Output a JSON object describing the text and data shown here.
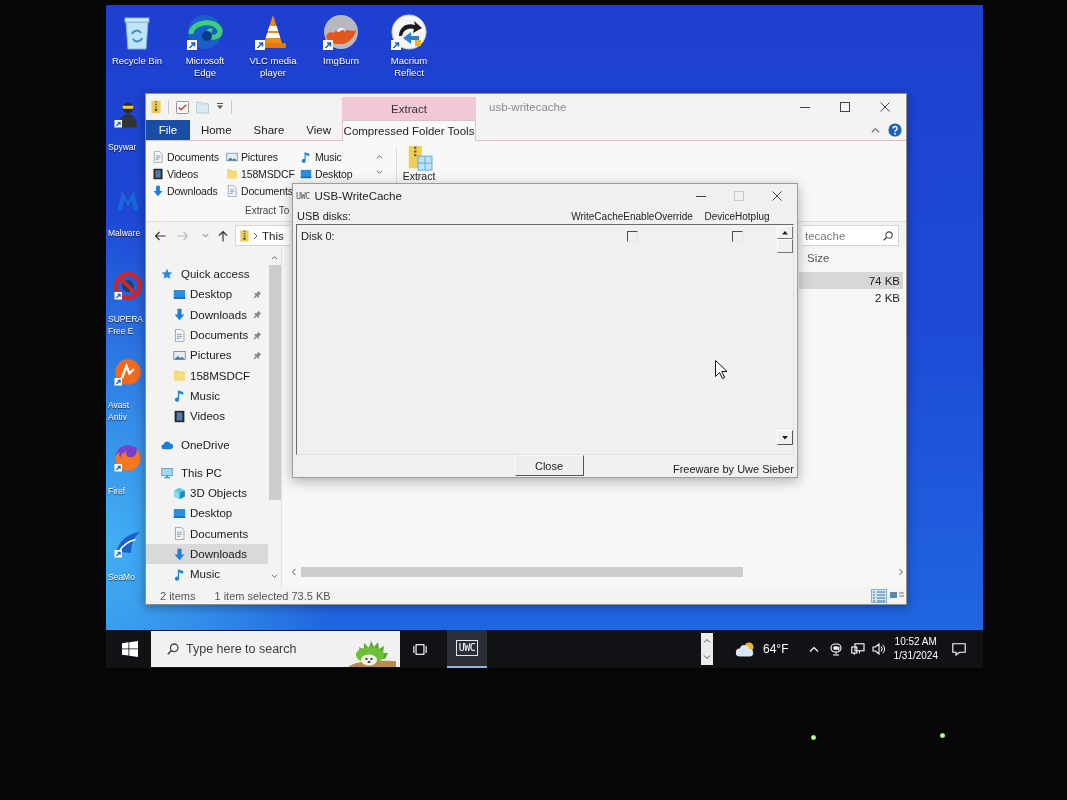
{
  "desktop": {
    "icons": [
      {
        "label": "Recycle Bin"
      },
      {
        "label": "Microsoft Edge"
      },
      {
        "label": "VLC media player"
      },
      {
        "label": "ImgBurn"
      },
      {
        "label": "Macrium Reflect"
      }
    ],
    "side_icons": [
      {
        "lines": [
          "Spywar"
        ]
      },
      {
        "lines": [
          "Malware"
        ]
      },
      {
        "lines": [
          "SUPERA",
          "Free E"
        ]
      },
      {
        "lines": [
          "Avast",
          "Antiv"
        ]
      },
      {
        "lines": [
          "Firef"
        ]
      },
      {
        "lines": [
          "SeaMo"
        ]
      }
    ]
  },
  "explorer": {
    "contextual_tab": "Extract",
    "title": "usb-writecache",
    "tabs": [
      {
        "label": "File",
        "kind": "file",
        "selected": false
      },
      {
        "label": "Home",
        "kind": "tab",
        "selected": false
      },
      {
        "label": "Share",
        "kind": "tab",
        "selected": false
      },
      {
        "label": "View",
        "kind": "tab",
        "selected": false
      },
      {
        "label": "Compressed Folder Tools",
        "kind": "contextual",
        "selected": true
      }
    ],
    "ribbon": {
      "locations": [
        {
          "label": "Documents"
        },
        {
          "label": "Pictures"
        },
        {
          "label": "Music"
        },
        {
          "label": "Videos"
        },
        {
          "label": "158MSDCF"
        },
        {
          "label": "Desktop"
        },
        {
          "label": "Downloads"
        },
        {
          "label": "Documents"
        }
      ],
      "group_label": "Extract To",
      "extract_button": "Extract"
    },
    "address": {
      "path": "This"
    },
    "search": {
      "placeholder": "tecache"
    },
    "nav": [
      {
        "label": "Quick access",
        "selected": false,
        "children": [
          {
            "label": "Desktop",
            "pinned": true,
            "selected": false
          },
          {
            "label": "Downloads",
            "pinned": true,
            "selected": false
          },
          {
            "label": "Documents",
            "pinned": true,
            "selected": false
          },
          {
            "label": "Pictures",
            "pinned": true,
            "selected": false
          },
          {
            "label": "158MSDCF",
            "pinned": false,
            "selected": false
          },
          {
            "label": "Music",
            "pinned": false,
            "selected": false
          },
          {
            "label": "Videos",
            "pinned": false,
            "selected": false
          }
        ]
      },
      {
        "label": "OneDrive",
        "selected": false
      },
      {
        "label": "This PC",
        "selected": false,
        "children": [
          {
            "label": "3D Objects",
            "selected": false
          },
          {
            "label": "Desktop",
            "selected": false
          },
          {
            "label": "Documents",
            "selected": false
          },
          {
            "label": "Downloads",
            "selected": true
          },
          {
            "label": "Music",
            "selected": false
          }
        ]
      }
    ],
    "files": {
      "columns": [
        "Size"
      ],
      "rows": [
        {
          "size": "74 KB",
          "selected": true
        },
        {
          "size": "2 KB",
          "selected": false
        }
      ]
    },
    "status_bar": {
      "count": "2 items",
      "selection": "1 item selected 73.5 KB"
    },
    "views": [
      {
        "selected": true
      },
      {
        "selected": false
      }
    ]
  },
  "dialog": {
    "icon_label": "UWC",
    "title": "USB-WriteCache",
    "controls": [
      {
        "kind": "minimize",
        "disabled": false
      },
      {
        "kind": "maximize",
        "disabled": true
      },
      {
        "kind": "close",
        "disabled": false
      }
    ],
    "list_label": "USB disks:",
    "columns": [
      "WriteCacheEnableOverride",
      "DeviceHotplug"
    ],
    "disks": [
      {
        "name": "Disk 0:",
        "options": [
          {
            "checked": false
          },
          {
            "checked": false
          }
        ]
      }
    ],
    "close_button": "Close",
    "credit": "Freeware by Uwe Sieber"
  },
  "taskbar": {
    "search": {
      "placeholder": "Type here to search"
    },
    "apps": [
      {
        "label": "UWC",
        "active": true
      }
    ],
    "weather": {
      "temperature": "64°F"
    },
    "clock": {
      "time": "10:52 AM",
      "date": "1/31/2024"
    }
  }
}
